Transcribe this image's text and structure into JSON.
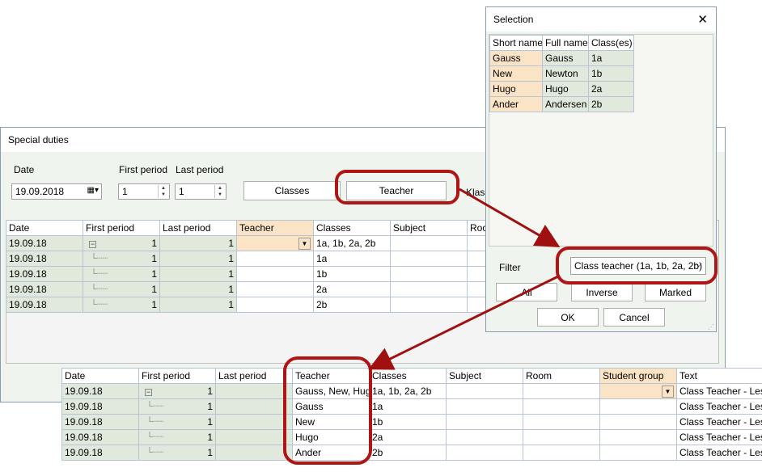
{
  "special_duties": {
    "title": "Special duties",
    "date_label": "Date",
    "date_value": "19.09.2018",
    "first_period_label": "First period",
    "first_period_value": "1",
    "last_period_label": "Last period",
    "last_period_value": "1",
    "buttons": {
      "classes": "Classes",
      "teacher": "Teacher",
      "klass_partial": "Klass"
    },
    "grid": {
      "columns": [
        "Date",
        "First period",
        "Last period",
        "Teacher",
        "Classes",
        "Subject",
        "Roo"
      ],
      "rows": [
        {
          "date": "19.09.18",
          "first": "1",
          "last": "1",
          "teacher": "",
          "classes": "1a, 1b, 2a, 2b"
        },
        {
          "date": "19.09.18",
          "first": "1",
          "last": "1",
          "teacher": "",
          "classes": "1a"
        },
        {
          "date": "19.09.18",
          "first": "1",
          "last": "1",
          "teacher": "",
          "classes": "1b"
        },
        {
          "date": "19.09.18",
          "first": "1",
          "last": "1",
          "teacher": "",
          "classes": "2a"
        },
        {
          "date": "19.09.18",
          "first": "1",
          "last": "1",
          "teacher": "",
          "classes": "2b"
        }
      ]
    }
  },
  "selection": {
    "title": "Selection",
    "close_glyph": "✕",
    "columns": [
      "Short name",
      "Full name",
      "Class(es)"
    ],
    "rows": [
      {
        "short": "Gauss",
        "full": "Gauss",
        "classes": "1a"
      },
      {
        "short": "New",
        "full": "Newton",
        "classes": "1b"
      },
      {
        "short": "Hugo",
        "full": "Hugo",
        "classes": "2a"
      },
      {
        "short": "Ander",
        "full": "Andersen",
        "classes": "2b"
      }
    ],
    "filter_label": "Filter",
    "filter_value": "Class teacher (1a, 1b, 2a, 2b)",
    "buttons": {
      "all": "All",
      "inverse": "Inverse",
      "marked": "Marked",
      "ok": "OK",
      "cancel": "Cancel"
    }
  },
  "result_grid": {
    "columns": [
      "Date",
      "First period",
      "Last period",
      "Teacher",
      "Classes",
      "Subject",
      "Room",
      "Student group",
      "Text"
    ],
    "rows": [
      {
        "date": "19.09.18",
        "first": "1",
        "last": "",
        "teacher": "Gauss, New, Hugo",
        "classes": "1a, 1b, 2a, 2b",
        "text": "Class Teacher - Les"
      },
      {
        "date": "19.09.18",
        "first": "1",
        "last": "",
        "teacher": "Gauss",
        "classes": "1a",
        "text": "Class Teacher - Les"
      },
      {
        "date": "19.09.18",
        "first": "1",
        "last": "",
        "teacher": "New",
        "classes": "1b",
        "text": "Class Teacher - Les"
      },
      {
        "date": "19.09.18",
        "first": "1",
        "last": "",
        "teacher": "Hugo",
        "classes": "2a",
        "text": "Class Teacher - Les"
      },
      {
        "date": "19.09.18",
        "first": "1",
        "last": "",
        "teacher": "Ander",
        "classes": "2b",
        "text": "Class Teacher - Les"
      }
    ]
  },
  "colors": {
    "highlight_ring": "#b01515",
    "arrow": "#a01010",
    "date_cell": "#e1e9dd",
    "header_highlight": "#fbe3c6"
  }
}
